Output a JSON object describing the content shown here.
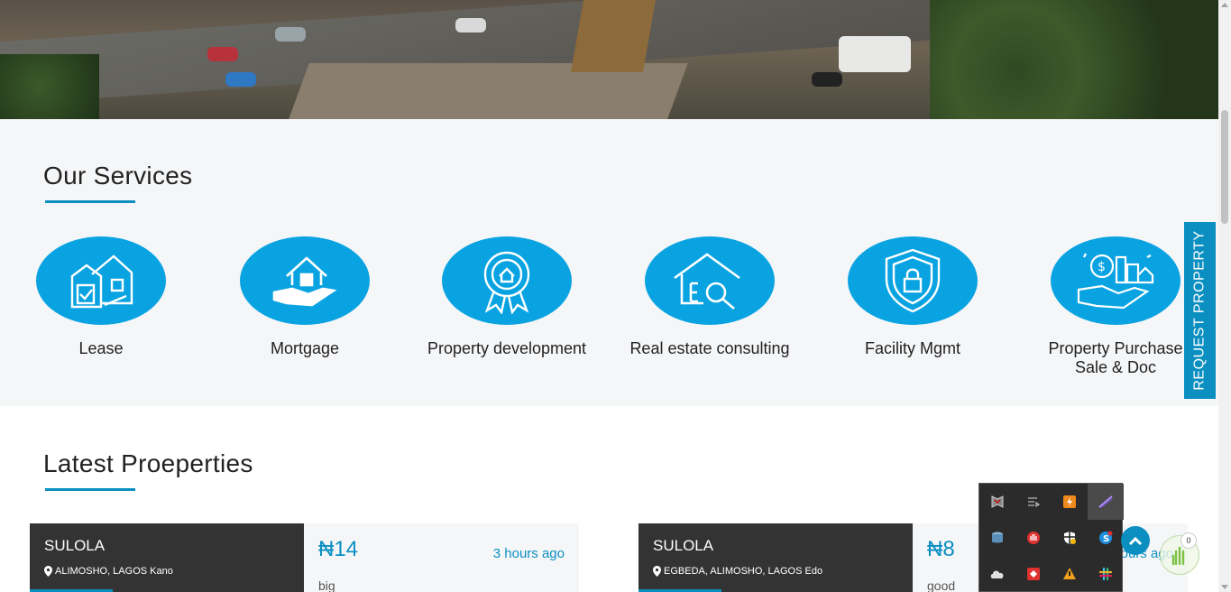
{
  "services": {
    "title": "Our Services",
    "items": [
      {
        "label": "Lease",
        "icon": "lease-icon"
      },
      {
        "label": "Mortgage",
        "icon": "mortgage-icon"
      },
      {
        "label": "Property development",
        "icon": "property-development-icon"
      },
      {
        "label": "Real estate consulting",
        "icon": "consulting-icon"
      },
      {
        "label": "Facility Mgmt",
        "icon": "facility-icon"
      },
      {
        "label": "Property Purchase Sale & Doc",
        "icon": "purchase-icon"
      }
    ]
  },
  "request_tab": "REQUEST PROPERTY",
  "latest": {
    "title": "Latest Proeperties",
    "cards": [
      {
        "name": "SULOLA",
        "location": "ALIMOSHO, LAGOS Kano",
        "price": "₦14",
        "time": "3 hours ago",
        "desc": "big"
      },
      {
        "name": "SULOLA",
        "location": "EGBEDA, ALIMOSHO, LAGOS Edo",
        "price": "₦8",
        "time": "hours ago",
        "desc": "good"
      }
    ]
  },
  "ext_badge_count": "0",
  "colors": {
    "accent": "#0b8fc1",
    "icon_bg": "#0aa3e2",
    "dark_card": "#333333"
  }
}
